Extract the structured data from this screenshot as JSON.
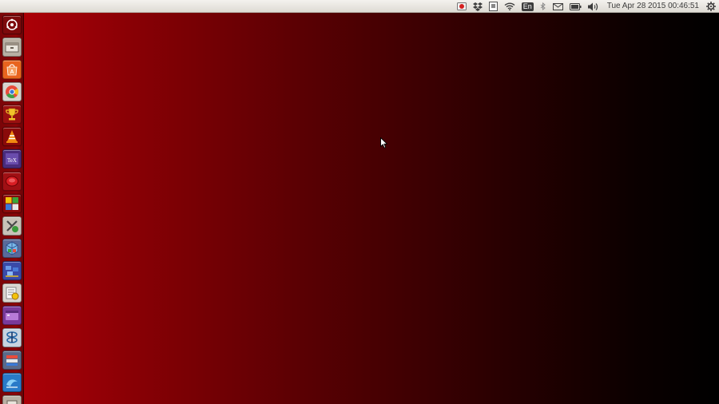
{
  "top_panel": {
    "clock": "Tue Apr 28 2015 00:46:51",
    "keyboard_layout": "En",
    "indicators": [
      "record-icon",
      "dropbox-icon",
      "document-icon",
      "wifi-icon",
      "keyboard-layout-indicator",
      "bluetooth-icon",
      "mail-icon",
      "battery-icon",
      "volume-icon",
      "clock",
      "settings-gear-icon"
    ]
  },
  "launcher": {
    "items": [
      {
        "name": "dash-home-icon",
        "color": "#7d0a0c"
      },
      {
        "name": "files-icon",
        "color": "#b8b0a4"
      },
      {
        "name": "software-center-icon",
        "color": "#e8641e"
      },
      {
        "name": "chrome-icon",
        "color": "#e84c3c"
      },
      {
        "name": "trophy-icon",
        "color": "#e0b020"
      },
      {
        "name": "vlc-icon",
        "color": "#f08a10"
      },
      {
        "name": "tex-icon",
        "color": "#5a2c8c"
      },
      {
        "name": "red-app-icon",
        "color": "#c8161c"
      },
      {
        "name": "colored-squares-icon",
        "color": "#4a9a2a"
      },
      {
        "name": "xmind-icon",
        "color": "#3a7a3a"
      },
      {
        "name": "virtualbox-icon",
        "color": "#4c70b8"
      },
      {
        "name": "blue-tiles-icon",
        "color": "#3a5ab8"
      },
      {
        "name": "notes-app-icon",
        "color": "#e8c020"
      },
      {
        "name": "purple-window-icon",
        "color": "#7a3a9a"
      },
      {
        "name": "blue-rings-icon",
        "color": "#2a6aa8"
      },
      {
        "name": "stack-app-icon",
        "color": "#5a6a8a"
      },
      {
        "name": "blue-shape-icon",
        "color": "#3a8ad8"
      }
    ]
  },
  "desktop": {
    "wallpaper_colors": [
      "#ac0007",
      "#000000"
    ]
  }
}
